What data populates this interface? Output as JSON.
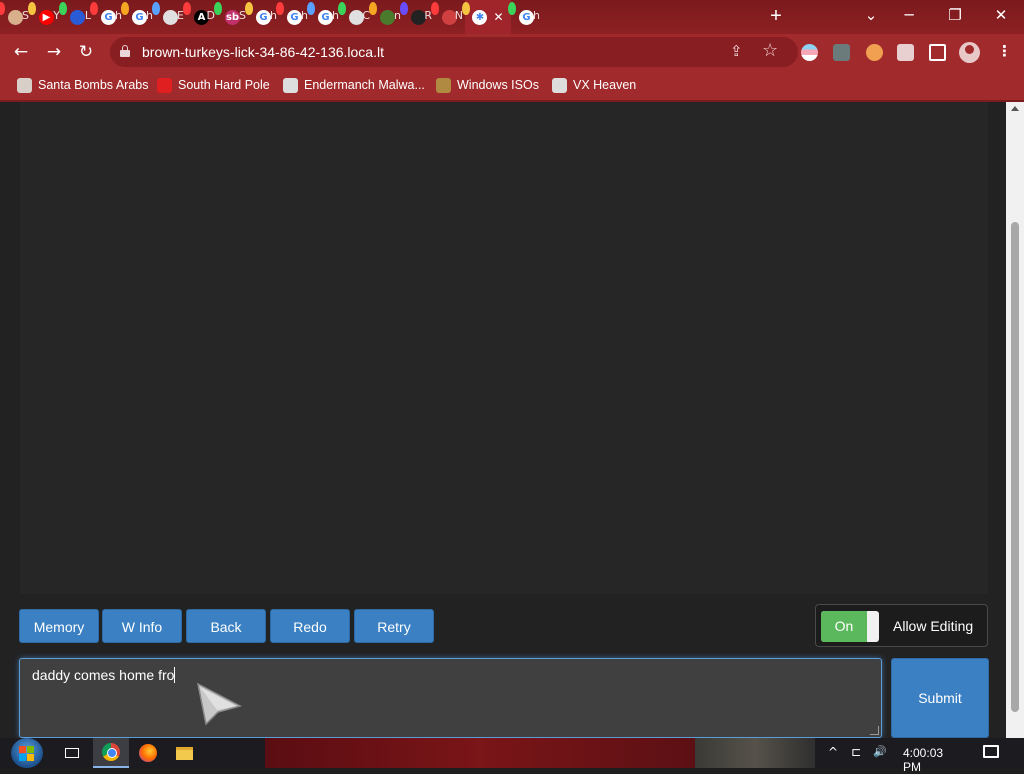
{
  "browser": {
    "tabs": [
      {
        "letter": "S",
        "icon_color": "#d9b08c",
        "bulb": "#ff3b3b"
      },
      {
        "letter": "Y",
        "icon_color": "#ff0000",
        "bulb": "#f5c542",
        "icon_text": "▶"
      },
      {
        "letter": "L",
        "icon_color": "#2a5bd7",
        "bulb": "#3bd35a"
      },
      {
        "letter": "h",
        "icon_color": "#ffffff",
        "bulb": "#ff3b3b",
        "icon_text": "G"
      },
      {
        "letter": "h",
        "icon_color": "#ffffff",
        "bulb": "#f5a623",
        "icon_text": "G"
      },
      {
        "letter": "E",
        "icon_color": "#e0e0e0",
        "bulb": "#5aa0ff"
      },
      {
        "letter": "D",
        "icon_color": "#000000",
        "bulb": "#ff3b3b",
        "icon_text": "A"
      },
      {
        "letter": "S",
        "icon_color": "#c0306a",
        "bulb": "#3bd35a",
        "icon_text": "sb"
      },
      {
        "letter": "h",
        "icon_color": "#ffffff",
        "bulb": "#f5c542",
        "icon_text": "G"
      },
      {
        "letter": "h",
        "icon_color": "#ffffff",
        "bulb": "#ff3b3b",
        "icon_text": "G"
      },
      {
        "letter": "h",
        "icon_color": "#ffffff",
        "bulb": "#5aa0ff",
        "icon_text": "G"
      },
      {
        "letter": "C",
        "icon_color": "#e0e0e0",
        "bulb": "#3bd35a"
      },
      {
        "letter": "n",
        "icon_color": "#4a7a2c",
        "bulb": "#f5a623"
      },
      {
        "letter": "R",
        "icon_color": "#222222",
        "bulb": "#6a4cff"
      },
      {
        "letter": "N",
        "icon_color": "#d04040",
        "bulb": "#ff3b3b"
      },
      {
        "letter": "",
        "icon_color": "#ffffff",
        "bulb": "#f5c542",
        "icon_text": "✱",
        "active": true,
        "close": "✕"
      },
      {
        "letter": "h",
        "icon_color": "#ffffff",
        "bulb": "#3bd35a",
        "icon_text": "G"
      }
    ],
    "new_tab": "+",
    "tab_search": "⌄",
    "minimize": "─",
    "restore": "❐",
    "close": "✕",
    "back": "←",
    "forward": "→",
    "reload": "↻",
    "url": "brown-turkeys-lick-34-86-42-136.loca.lt",
    "share": "⇪",
    "star": "☆",
    "menu": "⋮",
    "bookmarks": [
      {
        "label": "Santa Bombs Arabs",
        "icon_color": "#d8d0c8"
      },
      {
        "label": "South Hard Pole",
        "icon_color": "#e02020"
      },
      {
        "label": "Endermanch Malwa...",
        "icon_color": "#dddddd"
      },
      {
        "label": "Windows ISOs",
        "icon_color": "#b08a40"
      },
      {
        "label": "VX Heaven",
        "icon_color": "#dddddd"
      }
    ]
  },
  "app": {
    "buttons": {
      "memory": "Memory",
      "w_info": "W Info",
      "back": "Back",
      "redo": "Redo",
      "retry": "Retry"
    },
    "editing_toggle": {
      "state": "On",
      "label": "Allow Editing"
    },
    "prompt_text": "daddy comes home fro",
    "submit": "Submit"
  },
  "taskbar": {
    "time": "4:00:03 PM",
    "tray_chevron": "^",
    "network": "⊏",
    "volume": "🔊"
  },
  "colors": {
    "button_blue": "#3a80c3",
    "toggle_green": "#5cb85c",
    "chrome_red": "#a02a2c"
  }
}
